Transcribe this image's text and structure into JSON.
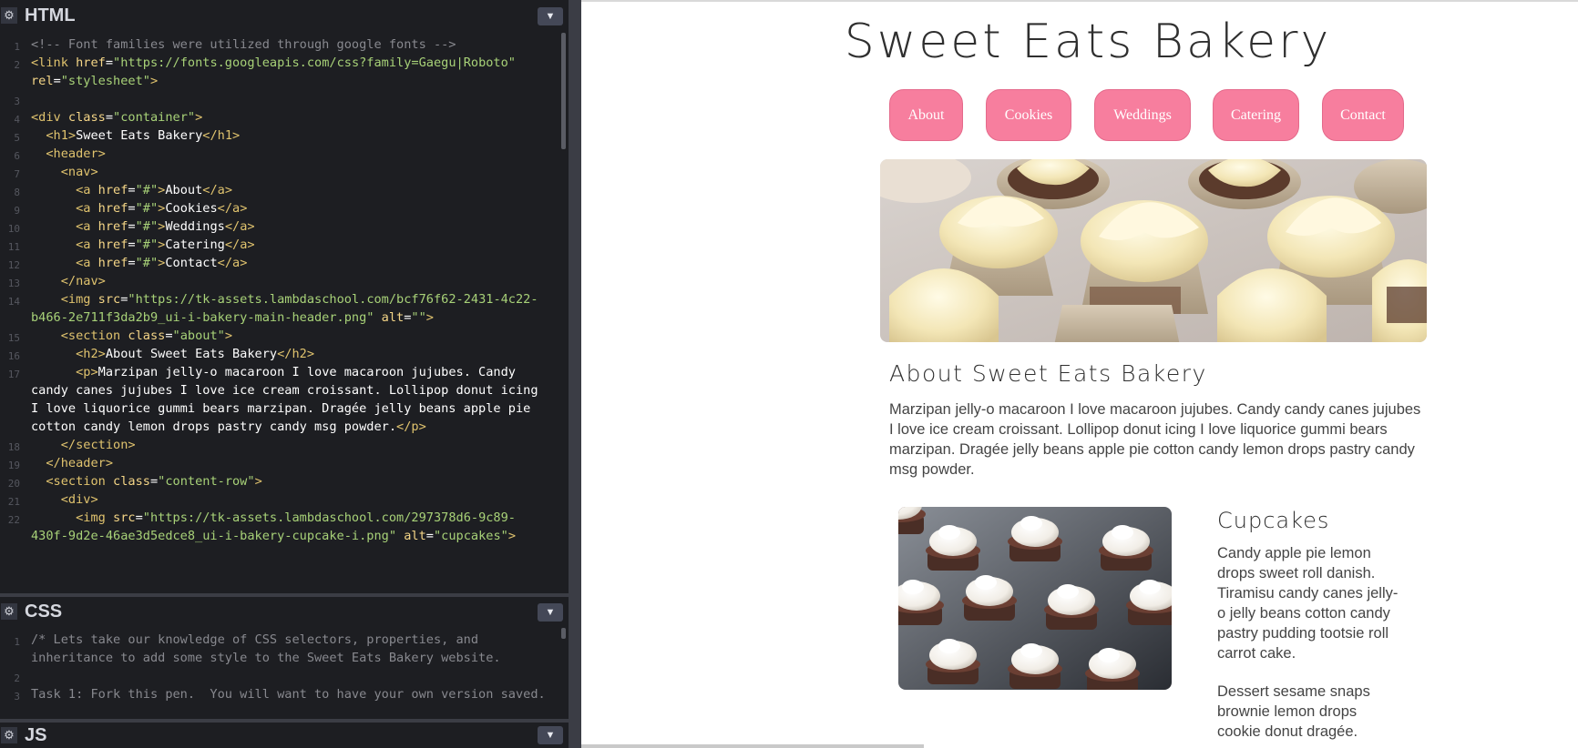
{
  "editor": {
    "html_pane": {
      "title": "HTML",
      "collapse_icon": "chevron-down-icon",
      "lines": [
        {
          "n": "1",
          "parts": [
            [
              "cmt",
              "<!-- Font families were utilized through google fonts -->"
            ]
          ]
        },
        {
          "n": "2",
          "parts": [
            [
              "tag",
              "<link "
            ],
            [
              "attr",
              "href"
            ],
            [
              "txt",
              "="
            ],
            [
              "str",
              "\"https://fonts.googleapis.com/css?family=Gaegu|Roboto\""
            ]
          ]
        },
        {
          "n": "",
          "parts": [
            [
              "attr",
              "rel"
            ],
            [
              "txt",
              "="
            ],
            [
              "str",
              "\"stylesheet\""
            ],
            [
              "tag",
              ">"
            ]
          ]
        },
        {
          "n": "3",
          "parts": []
        },
        {
          "n": "4",
          "parts": [
            [
              "tag",
              "<div "
            ],
            [
              "attr",
              "class"
            ],
            [
              "txt",
              "="
            ],
            [
              "str",
              "\"container\""
            ],
            [
              "tag",
              ">"
            ]
          ]
        },
        {
          "n": "5",
          "parts": [
            [
              "txt",
              "  "
            ],
            [
              "tag",
              "<h1>"
            ],
            [
              "txt",
              "Sweet Eats Bakery"
            ],
            [
              "tag",
              "</h1>"
            ]
          ]
        },
        {
          "n": "6",
          "parts": [
            [
              "txt",
              "  "
            ],
            [
              "tag",
              "<header>"
            ]
          ]
        },
        {
          "n": "7",
          "parts": [
            [
              "txt",
              "    "
            ],
            [
              "tag",
              "<nav>"
            ]
          ]
        },
        {
          "n": "8",
          "parts": [
            [
              "txt",
              "      "
            ],
            [
              "tag",
              "<a "
            ],
            [
              "attr",
              "href"
            ],
            [
              "txt",
              "="
            ],
            [
              "str",
              "\"#\""
            ],
            [
              "tag",
              ">"
            ],
            [
              "txt",
              "About"
            ],
            [
              "tag",
              "</a>"
            ]
          ]
        },
        {
          "n": "9",
          "parts": [
            [
              "txt",
              "      "
            ],
            [
              "tag",
              "<a "
            ],
            [
              "attr",
              "href"
            ],
            [
              "txt",
              "="
            ],
            [
              "str",
              "\"#\""
            ],
            [
              "tag",
              ">"
            ],
            [
              "txt",
              "Cookies"
            ],
            [
              "tag",
              "</a>"
            ]
          ]
        },
        {
          "n": "10",
          "parts": [
            [
              "txt",
              "      "
            ],
            [
              "tag",
              "<a "
            ],
            [
              "attr",
              "href"
            ],
            [
              "txt",
              "="
            ],
            [
              "str",
              "\"#\""
            ],
            [
              "tag",
              ">"
            ],
            [
              "txt",
              "Weddings"
            ],
            [
              "tag",
              "</a>"
            ]
          ]
        },
        {
          "n": "11",
          "parts": [
            [
              "txt",
              "      "
            ],
            [
              "tag",
              "<a "
            ],
            [
              "attr",
              "href"
            ],
            [
              "txt",
              "="
            ],
            [
              "str",
              "\"#\""
            ],
            [
              "tag",
              ">"
            ],
            [
              "txt",
              "Catering"
            ],
            [
              "tag",
              "</a>"
            ]
          ]
        },
        {
          "n": "12",
          "parts": [
            [
              "txt",
              "      "
            ],
            [
              "tag",
              "<a "
            ],
            [
              "attr",
              "href"
            ],
            [
              "txt",
              "="
            ],
            [
              "str",
              "\"#\""
            ],
            [
              "tag",
              ">"
            ],
            [
              "txt",
              "Contact"
            ],
            [
              "tag",
              "</a>"
            ]
          ]
        },
        {
          "n": "13",
          "parts": [
            [
              "txt",
              "    "
            ],
            [
              "tag",
              "</nav>"
            ]
          ]
        },
        {
          "n": "14",
          "parts": [
            [
              "txt",
              "    "
            ],
            [
              "tag",
              "<img "
            ],
            [
              "attr",
              "src"
            ],
            [
              "txt",
              "="
            ],
            [
              "str",
              "\"https://tk-assets.lambdaschool.com/bcf76f62-2431-4c22-"
            ]
          ]
        },
        {
          "n": "",
          "parts": [
            [
              "str",
              "b466-2e711f3da2b9_ui-i-bakery-main-header.png\""
            ],
            [
              "txt",
              " "
            ],
            [
              "attr",
              "alt"
            ],
            [
              "txt",
              "="
            ],
            [
              "str",
              "\"\""
            ],
            [
              "tag",
              ">"
            ]
          ]
        },
        {
          "n": "15",
          "parts": [
            [
              "txt",
              "    "
            ],
            [
              "tag",
              "<section "
            ],
            [
              "attr",
              "class"
            ],
            [
              "txt",
              "="
            ],
            [
              "str",
              "\"about\""
            ],
            [
              "tag",
              ">"
            ]
          ]
        },
        {
          "n": "16",
          "parts": [
            [
              "txt",
              "      "
            ],
            [
              "tag",
              "<h2>"
            ],
            [
              "txt",
              "About Sweet Eats Bakery"
            ],
            [
              "tag",
              "</h2>"
            ]
          ]
        },
        {
          "n": "17",
          "parts": [
            [
              "txt",
              "      "
            ],
            [
              "tag",
              "<p>"
            ],
            [
              "txt",
              "Marzipan jelly-o macaroon I love macaroon jujubes. Candy"
            ]
          ]
        },
        {
          "n": "",
          "parts": [
            [
              "txt",
              "candy canes jujubes I love ice cream croissant. Lollipop donut icing"
            ]
          ]
        },
        {
          "n": "",
          "parts": [
            [
              "txt",
              "I love liquorice gummi bears marzipan. Dragée jelly beans apple pie"
            ]
          ]
        },
        {
          "n": "",
          "parts": [
            [
              "txt",
              "cotton candy lemon drops pastry candy msg powder."
            ],
            [
              "tag",
              "</p>"
            ]
          ]
        },
        {
          "n": "18",
          "parts": [
            [
              "txt",
              "    "
            ],
            [
              "tag",
              "</section>"
            ]
          ]
        },
        {
          "n": "19",
          "parts": [
            [
              "txt",
              "  "
            ],
            [
              "tag",
              "</header>"
            ]
          ]
        },
        {
          "n": "20",
          "parts": [
            [
              "txt",
              "  "
            ],
            [
              "tag",
              "<section "
            ],
            [
              "attr",
              "class"
            ],
            [
              "txt",
              "="
            ],
            [
              "str",
              "\"content-row\""
            ],
            [
              "tag",
              ">"
            ]
          ]
        },
        {
          "n": "21",
          "parts": [
            [
              "txt",
              "    "
            ],
            [
              "tag",
              "<div>"
            ]
          ]
        },
        {
          "n": "22",
          "parts": [
            [
              "txt",
              "      "
            ],
            [
              "tag",
              "<img "
            ],
            [
              "attr",
              "src"
            ],
            [
              "txt",
              "="
            ],
            [
              "str",
              "\"https://tk-assets.lambdaschool.com/297378d6-9c89-"
            ]
          ]
        },
        {
          "n": "",
          "parts": [
            [
              "str",
              "430f-9d2e-46ae3d5edce8_ui-i-bakery-cupcake-i.png\""
            ],
            [
              "txt",
              " "
            ],
            [
              "attr",
              "alt"
            ],
            [
              "txt",
              "="
            ],
            [
              "str",
              "\"cupcakes\""
            ],
            [
              "tag",
              ">"
            ]
          ]
        }
      ]
    },
    "css_pane": {
      "title": "CSS",
      "lines": [
        {
          "n": "1",
          "text": "/* Lets take our knowledge of CSS selectors, properties, and"
        },
        {
          "n": "",
          "text": "inheritance to add some style to the Sweet Eats Bakery website."
        },
        {
          "n": "2",
          "text": ""
        },
        {
          "n": "3",
          "text": "Task 1: Fork this pen.  You will want to have your own version saved."
        }
      ]
    },
    "js_pane": {
      "title": "JS"
    }
  },
  "preview": {
    "site_title": "Sweet Eats Bakery",
    "nav": [
      "About",
      "Cookies",
      "Weddings",
      "Catering",
      "Contact"
    ],
    "nav_color": "#f77e9e",
    "hero_alt": "",
    "about": {
      "heading": "About Sweet Eats Bakery",
      "text": "Marzipan jelly-o macaroon I love macaroon jujubes. Candy candy canes jujubes I love ice cream croissant. Lollipop donut icing I love liquorice gummi bears marzipan. Dragée jelly beans apple pie cotton candy lemon drops pastry candy msg powder."
    },
    "cupcakes": {
      "heading": "Cupcakes",
      "img_alt": "cupcakes",
      "p1": "Candy apple pie lemon drops sweet roll danish. Tiramisu candy canes jelly-o jelly beans cotton candy pastry pudding tootsie roll carrot cake.",
      "p2": "Dessert sesame snaps brownie lemon drops cookie donut dragée."
    }
  }
}
